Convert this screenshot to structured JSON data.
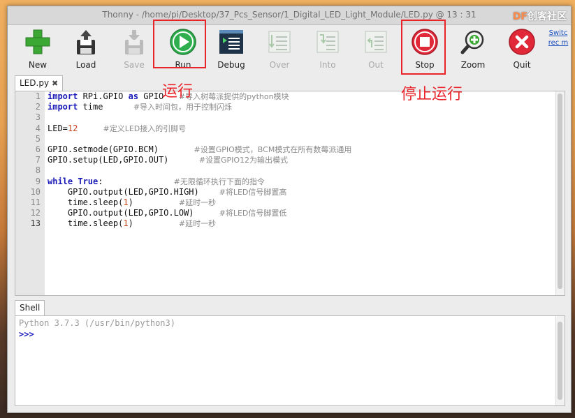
{
  "window": {
    "title": "Thonny  -  /home/pi/Desktop/37_Pcs_Sensor/1_Digital_LED_Light_Module/LED.py  @  13 : 31"
  },
  "watermark": {
    "prefix": "DF",
    "text": "创客社区"
  },
  "toolbar": {
    "buttons": [
      {
        "label": "New",
        "icon": "new-file-icon",
        "enabled": true
      },
      {
        "label": "Load",
        "icon": "load-floppy-icon",
        "enabled": true
      },
      {
        "label": "Save",
        "icon": "save-floppy-icon",
        "enabled": false
      },
      {
        "label": "Run",
        "icon": "run-play-icon",
        "enabled": true
      },
      {
        "label": "Debug",
        "icon": "debug-icon",
        "enabled": true
      },
      {
        "label": "Over",
        "icon": "step-over-icon",
        "enabled": false
      },
      {
        "label": "Into",
        "icon": "step-into-icon",
        "enabled": false
      },
      {
        "label": "Out",
        "icon": "step-out-icon",
        "enabled": false
      },
      {
        "label": "Stop",
        "icon": "stop-icon",
        "enabled": true
      },
      {
        "label": "Zoom",
        "icon": "zoom-icon",
        "enabled": true
      },
      {
        "label": "Quit",
        "icon": "quit-icon",
        "enabled": true
      }
    ],
    "switch_link": "Switc rec m"
  },
  "annotations": {
    "run": "运行",
    "stop": "停止运行"
  },
  "editor": {
    "tab_label": "LED.py",
    "tab_close": "✖",
    "line_numbers": [
      "1",
      "2",
      "3",
      "4",
      "5",
      "6",
      "7",
      "8",
      "9",
      "10",
      "11",
      "12",
      "13"
    ]
  },
  "shell": {
    "tab_label": "Shell",
    "version_line": "Python 3.7.3 (/usr/bin/python3)",
    "prompt": ">>>"
  },
  "colors": {
    "highlight": "#e8232a",
    "keyword": "#1a1ab8",
    "number": "#c8461e",
    "comment": "#8a8a8a"
  }
}
